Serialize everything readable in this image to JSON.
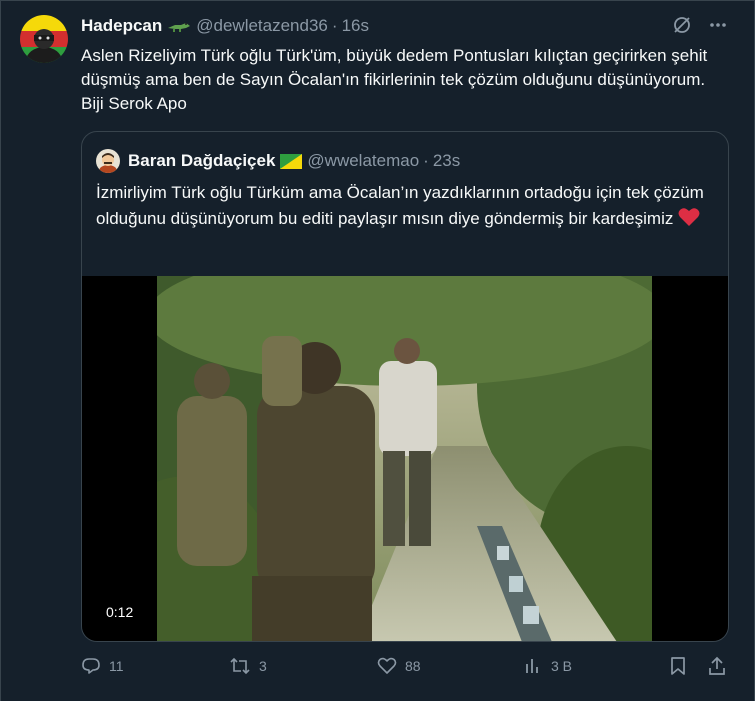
{
  "tweet": {
    "author_name": "Hadepcan",
    "author_emoji": "crocodile-emoji",
    "handle": "@dewletazend36",
    "separator": "·",
    "time": "16s",
    "text": "Aslen Rizeliyim Türk oğlu Türk'üm, büyük dedem Pontusları kılıçtan geçirirken şehit düşmüş ama ben de Sayın Öcalan'ın fikirlerinin tek çözüm olduğunu düşünüyorum. Biji Serok Apo"
  },
  "quote": {
    "author_name": "Baran Dağdaçiçek",
    "author_emoji": "flag-emoji",
    "handle": "@wwelatemao",
    "separator": "·",
    "time": "23s",
    "text": "İzmirliyim Türk oğlu Türküm ama Öcalan’ın yazdıklarının ortadoğu için tek çözüm olduğunu düşünüyorum bu editi paylaşır mısın diye göndermiş bir kardeşimiz",
    "heart": "❤️",
    "video_duration": "0:12"
  },
  "actions": {
    "replies": "11",
    "retweets": "3",
    "likes": "88",
    "views": "3 B"
  },
  "colors": {
    "background": "#15202b",
    "border": "#38444d",
    "text_primary": "#f7f9f9",
    "text_secondary": "#8b98a5"
  }
}
